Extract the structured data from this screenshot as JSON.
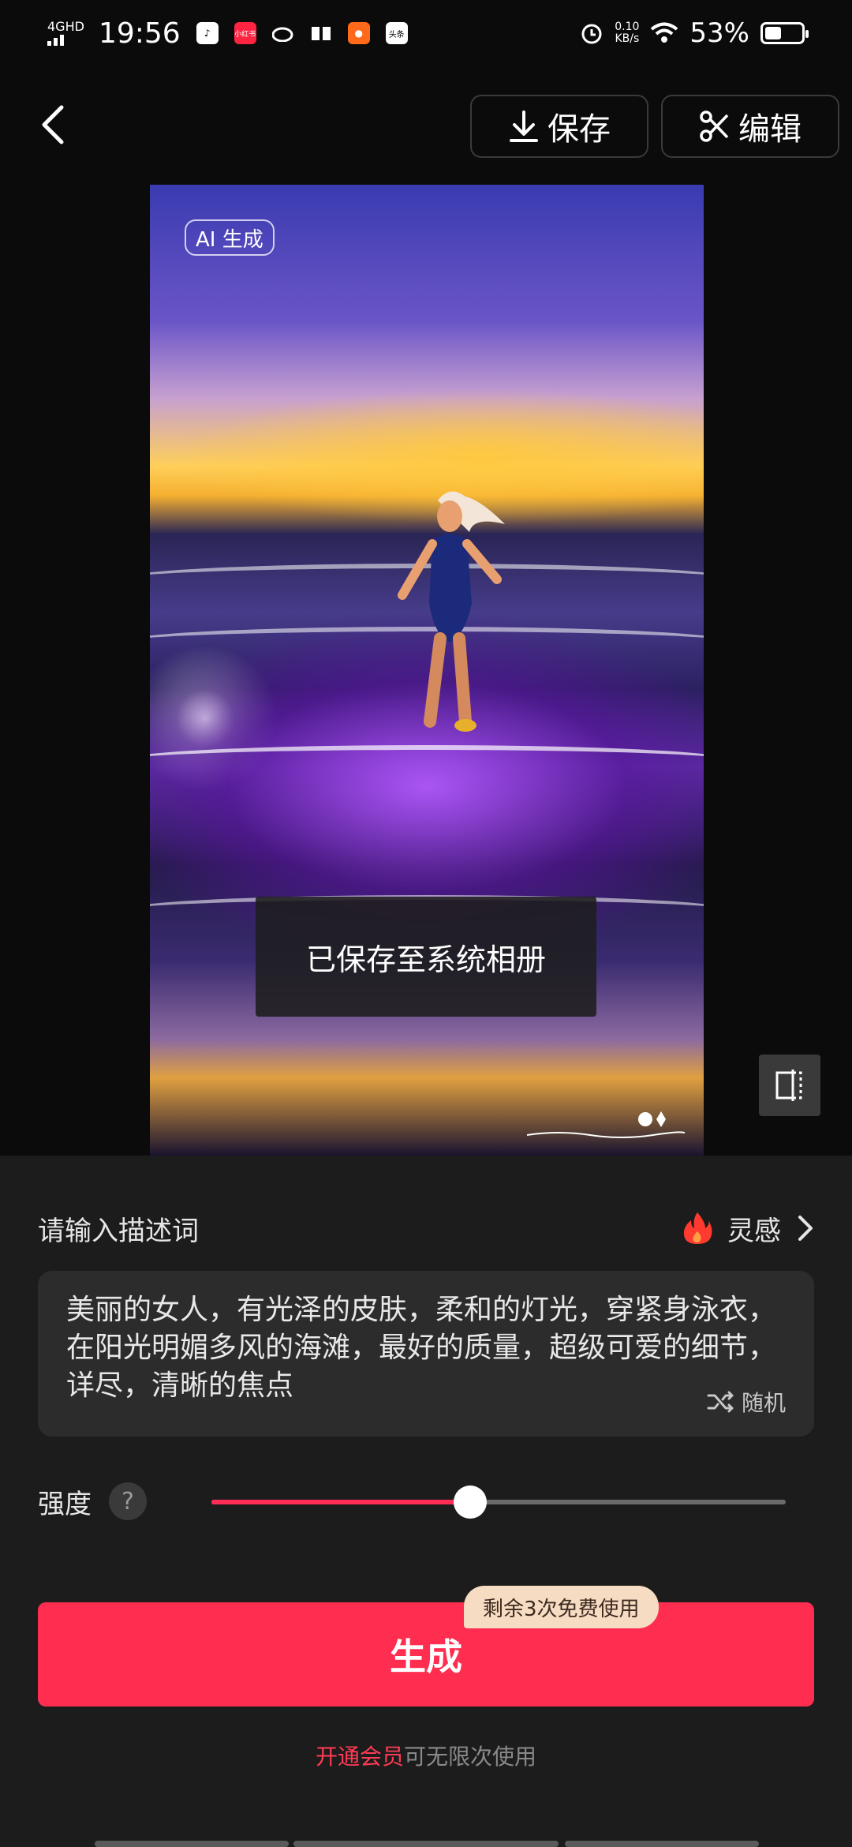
{
  "status_bar": {
    "network": "4GHD",
    "time": "19:56",
    "app_icons": [
      "tiktok-icon",
      "xiaohongshu-icon",
      "weibo-icon",
      "book-icon",
      "kuaishou-icon",
      "toutiao-icon"
    ],
    "xiaohongshu_label": "小红书",
    "toutiao_label": "头条",
    "speed_value": "0.10",
    "speed_unit": "KB/s",
    "battery_text": "53%",
    "battery_level": 0.53
  },
  "nav": {
    "save_label": "保存",
    "edit_label": "编辑"
  },
  "image": {
    "badge": "AI 生成"
  },
  "toast": {
    "text": "已保存至系统相册"
  },
  "prompt": {
    "label": "请输入描述词",
    "inspiration_label": "灵感",
    "text": "美丽的女人，有光泽的皮肤，柔和的灯光，穿紧身泳衣，在阳光明媚多风的海滩，最好的质量，超级可爱的细节，详尽，清晰的焦点",
    "random_label": "随机"
  },
  "strength": {
    "label": "强度",
    "help": "?",
    "value": 0.45
  },
  "generate": {
    "label": "生成",
    "free_badge": "剩余3次免费使用"
  },
  "membership": {
    "link": "开通会员",
    "rest": "可无限次使用"
  },
  "colors": {
    "accent": "#ff2d4f",
    "badge_bg": "#f7dcc4",
    "panel_bg": "#1c1c1c"
  }
}
